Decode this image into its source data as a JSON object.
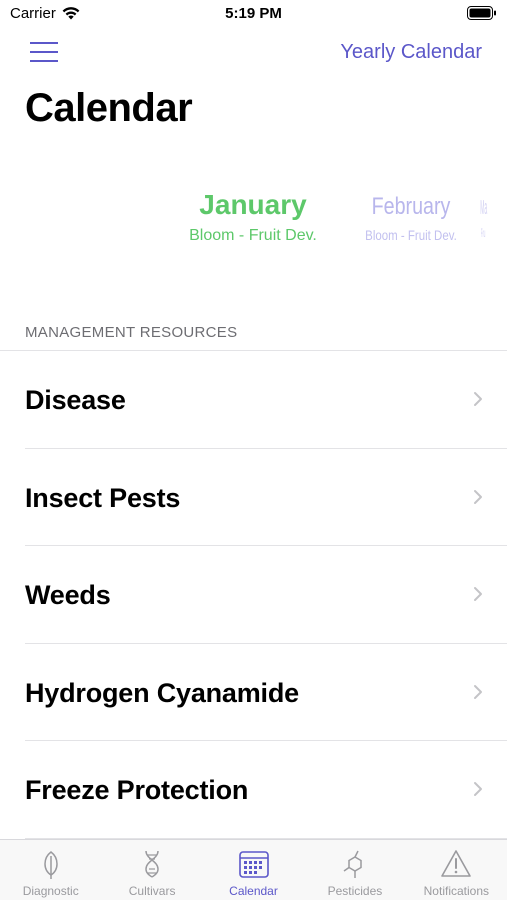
{
  "status_bar": {
    "carrier": "Carrier",
    "time": "5:19 PM"
  },
  "nav": {
    "menu_icon": "hamburger-menu-icon",
    "action_label": "Yearly Calendar"
  },
  "page": {
    "title": "Calendar"
  },
  "month_picker": {
    "months": [
      {
        "name": "January",
        "stage": "Bloom - Fruit Dev.",
        "selected": true
      },
      {
        "name": "February",
        "stage": "Bloom - Fruit Dev.",
        "selected": false
      },
      {
        "name": "Ma",
        "stage": "Fru",
        "selected": false
      }
    ]
  },
  "resources": {
    "header": "MANAGEMENT RESOURCES",
    "items": [
      {
        "label": "Disease"
      },
      {
        "label": "Insect Pests"
      },
      {
        "label": "Weeds"
      },
      {
        "label": "Hydrogen Cyanamide"
      },
      {
        "label": "Freeze Protection"
      }
    ]
  },
  "tab_bar": {
    "tabs": [
      {
        "label": "Diagnostic",
        "icon": "leaf-icon",
        "active": false
      },
      {
        "label": "Cultivars",
        "icon": "dna-icon",
        "active": false
      },
      {
        "label": "Calendar",
        "icon": "calendar-icon",
        "active": true
      },
      {
        "label": "Pesticides",
        "icon": "molecule-icon",
        "active": false
      },
      {
        "label": "Notifications",
        "icon": "warning-icon",
        "active": false
      }
    ]
  },
  "colors": {
    "accent": "#5b57c9",
    "current_month": "#5dc86a",
    "inactive_tab": "#9a9a9e"
  }
}
